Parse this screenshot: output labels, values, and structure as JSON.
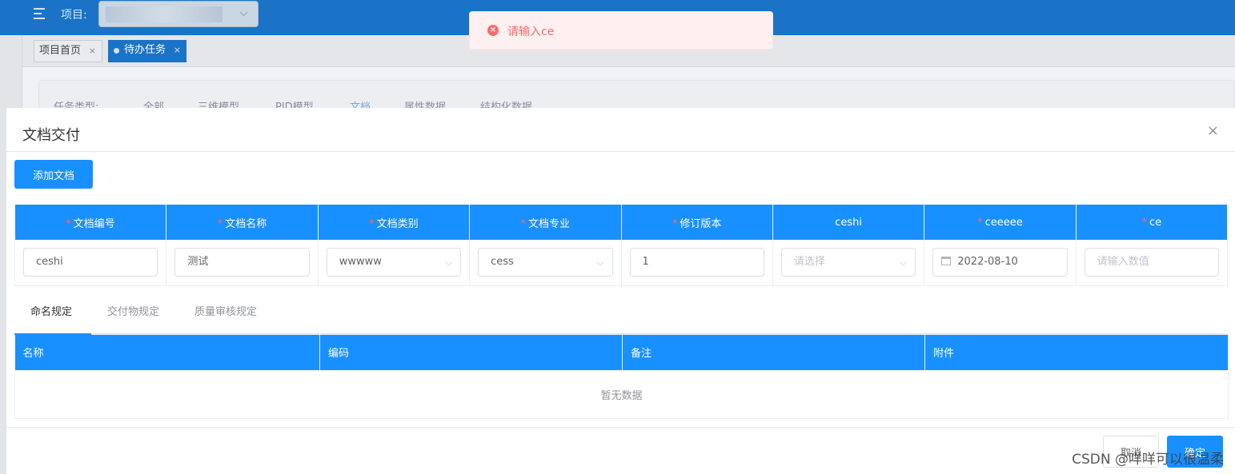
{
  "header": {
    "project_label": "项目:"
  },
  "tabs": [
    {
      "label": "项目首页",
      "close": "×"
    },
    {
      "label": "待办任务",
      "close": "×"
    }
  ],
  "filter": {
    "task_type_label": "任务类型:",
    "options": [
      "全部",
      "三维模型",
      "PID模型",
      "文档",
      "属性数据",
      "结构化数据"
    ]
  },
  "toast": {
    "message": "请输入ce",
    "type_color": "#f56c6c"
  },
  "dialog": {
    "title": "文档交付",
    "close": "×",
    "add_button": "添加文档",
    "columns": [
      {
        "label": "文档编号",
        "required": true
      },
      {
        "label": "文档名称",
        "required": true
      },
      {
        "label": "文档类别",
        "required": true
      },
      {
        "label": "文档专业",
        "required": true
      },
      {
        "label": "修订版本",
        "required": true
      },
      {
        "label": "ceshi",
        "required": false
      },
      {
        "label": "ceeeee",
        "required": true
      },
      {
        "label": "ce",
        "required": true
      }
    ],
    "row": {
      "doc_no": "ceshi",
      "doc_name": "测试",
      "doc_category": "wwwww",
      "doc_discipline": "cess",
      "revision": "1",
      "ceshi_placeholder": "请选择",
      "ceeeee_date": "2022-08-10",
      "ce_placeholder": "请输入数值"
    },
    "rule_tabs": [
      "命名规定",
      "交付物规定",
      "质量审核规定"
    ],
    "rule_columns": [
      "名称",
      "编码",
      "备注",
      "附件"
    ],
    "empty_text": "暂无数据",
    "cancel_button": "取消",
    "confirm_button": "确定"
  },
  "watermark": "CSDN @咩咩可以很温柔",
  "colors": {
    "primary": "#1890ff",
    "header_bg": "#1a73c7",
    "required": "#f56c6c"
  }
}
